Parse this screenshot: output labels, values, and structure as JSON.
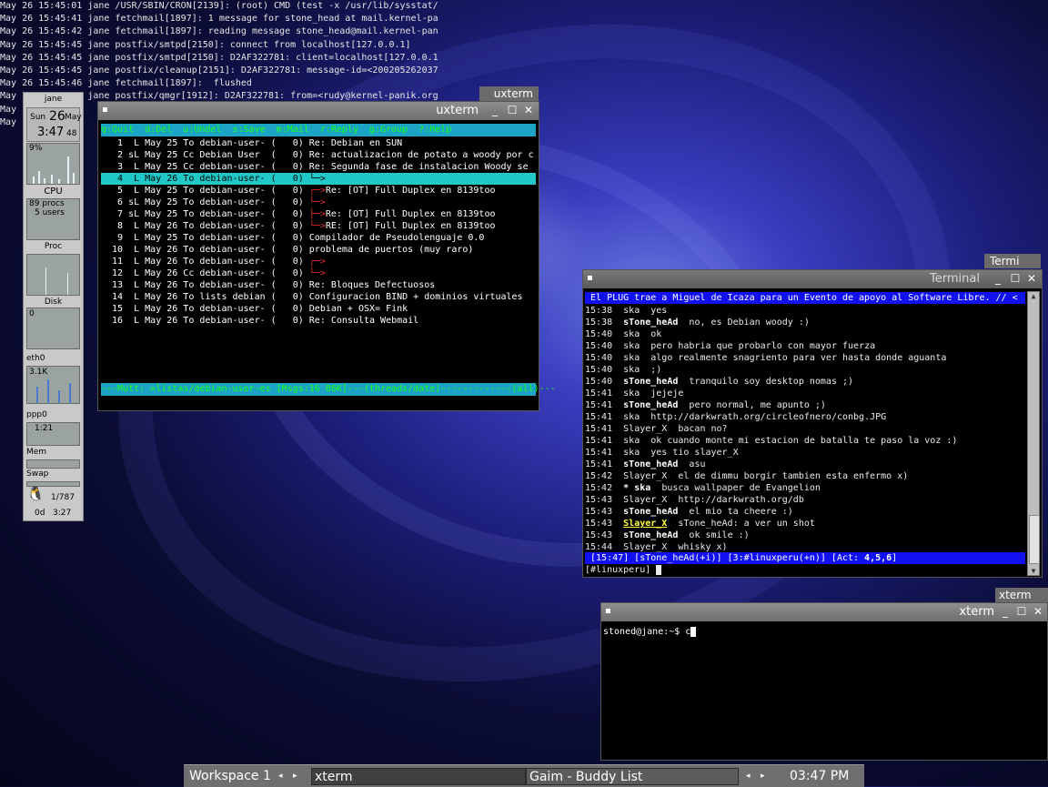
{
  "root_log": [
    "May 26 15:45:01 jane /USR/SBIN/CRON[2139]: (root) CMD (test -x /usr/lib/sysstat/",
    "May 26 15:45:41 jane fetchmail[1897]: 1 message for stone_head at mail.kernel-pa",
    "May 26 15:45:42 jane fetchmail[1897]: reading message stone_head@mail.kernel-pan",
    "May 26 15:45:45 jane postfix/smtpd[2150]: connect from localhost[127.0.0.1]",
    "May 26 15:45:45 jane postfix/smtpd[2150]: D2AF322781: client=localhost[127.0.0.1",
    "May 26 15:45:45 jane postfix/cleanup[2151]: D2AF322781: message-id=<200205262037",
    "May 26 15:45:46 jane fetchmail[1897]:  flushed",
    "May 26 15:45:46 jane postfix/qmgr[1912]: D2AF322781: from=<rudy@kernel-panik.org",
    "May",
    "May"
  ],
  "monitor": {
    "host": "jane",
    "day": "Sun",
    "date": "26",
    "month": "May",
    "time": "3:47",
    "seconds": "48",
    "cpu_pct": "9%",
    "cpu_label": "CPU",
    "procs": "89 procs",
    "users": "5 users",
    "proc_label": "Proc",
    "disk_label": "Disk",
    "disk_val": "0",
    "eth_label": "eth0",
    "eth_val": "3.1K",
    "ppp_label": "ppp0",
    "ppp_val": "1:21",
    "mem_label": "Mem",
    "swap_label": "Swap",
    "mail_count": "1/787",
    "uptime_days": "0d",
    "uptime_time": "3:27"
  },
  "uxterm_back": {
    "title": "uxterm"
  },
  "mutt": {
    "title": "uxterm",
    "help_bar": "q:Quit  d:Del  u:Undel  s:Save  m:Mail  r:Reply  g:Group  ?:Help",
    "status_bar": "---Mutt: =listas/debian-user-es [Msgs:16 86K]---(threads/date)-------------(all)---",
    "rows": [
      {
        "n": "1",
        "f": " L",
        "date": "May 25",
        "who": "To debian-user-",
        "cnt": "(   0)",
        "tree": "",
        "subj": "Re: Debian en SUN"
      },
      {
        "n": "2",
        "f": "sL",
        "date": "May 25",
        "who": "Cc Debian User ",
        "cnt": "(   0)",
        "tree": "",
        "subj": "Re: actualizacion de potato a woody por c"
      },
      {
        "n": "3",
        "f": " L",
        "date": "May 25",
        "who": "Cc debian-user-",
        "cnt": "(   0)",
        "tree": "",
        "subj": "Re: Segunda fase de instalacion Woody se"
      },
      {
        "n": "4",
        "f": " L",
        "date": "May 26",
        "who": "To debian-user-",
        "cnt": "(   0)",
        "tree": "└─>",
        "subj": ""
      },
      {
        "n": "5",
        "f": " L",
        "date": "May 25",
        "who": "To debian-user-",
        "cnt": "(   0)",
        "tree": "┌─>",
        "subj": "Re: [OT] Full Duplex en 8139too"
      },
      {
        "n": "6",
        "f": "sL",
        "date": "May 25",
        "who": "To debian-user-",
        "cnt": "(   0)",
        "tree": "└─>",
        "subj": ""
      },
      {
        "n": "7",
        "f": "sL",
        "date": "May 25",
        "who": "To debian-user-",
        "cnt": "(   0)",
        "tree": "├─>",
        "subj": "Re: [OT] Full Duplex en 8139too"
      },
      {
        "n": "8",
        "f": " L",
        "date": "May 26",
        "who": "To debian-user-",
        "cnt": "(   0)",
        "tree": "└─>",
        "subj": "RE: [OT] Full Duplex en 8139too"
      },
      {
        "n": "9",
        "f": " L",
        "date": "May 25",
        "who": "To debian-user-",
        "cnt": "(   0)",
        "tree": "",
        "subj": "Compilador de Pseudolenguaje 0.0"
      },
      {
        "n": "10",
        "f": " L",
        "date": "May 26",
        "who": "To debian-user-",
        "cnt": "(   0)",
        "tree": "",
        "subj": "problema de puertos (muy raro)"
      },
      {
        "n": "11",
        "f": " L",
        "date": "May 26",
        "who": "To debian-user-",
        "cnt": "(   0)",
        "tree": "┌─>",
        "subj": ""
      },
      {
        "n": "12",
        "f": " L",
        "date": "May 26",
        "who": "Cc debian-user-",
        "cnt": "(   0)",
        "tree": "└─>",
        "subj": ""
      },
      {
        "n": "13",
        "f": " L",
        "date": "May 26",
        "who": "To debian-user-",
        "cnt": "(   0)",
        "tree": "",
        "subj": "Re: Bloques Defectuosos"
      },
      {
        "n": "14",
        "f": " L",
        "date": "May 26",
        "who": "To lists debian",
        "cnt": "(   0)",
        "tree": "",
        "subj": "Configuracion BIND + dominios virtuales"
      },
      {
        "n": "15",
        "f": " L",
        "date": "May 26",
        "who": "To debian-user-",
        "cnt": "(   0)",
        "tree": "",
        "subj": "Debian + OSX= Fink"
      },
      {
        "n": "16",
        "f": " L",
        "date": "May 26",
        "who": "To debian-user-",
        "cnt": "(   0)",
        "tree": "",
        "subj": "Re: Consulta Webmail"
      }
    ]
  },
  "termi_back": {
    "title": "Termi"
  },
  "irc": {
    "title": "Terminal",
    "topic": " El PLUG trae a Miguel de Icaza para un Evento de apoyo al Software Libre. // <",
    "lines": [
      {
        "t": "15:38",
        "nick": "ska",
        "style": "n",
        "msg": "yes"
      },
      {
        "t": "15:38",
        "nick": "sTone_heAd",
        "style": "b",
        "msg": "no, es Debian woody :)"
      },
      {
        "t": "15:40",
        "nick": "ska",
        "style": "n",
        "msg": "ok"
      },
      {
        "t": "15:40",
        "nick": "ska",
        "style": "n",
        "msg": "pero habria que probarlo con mayor fuerza"
      },
      {
        "t": "15:40",
        "nick": "ska",
        "style": "n",
        "msg": "algo realmente snagriento para ver hasta donde aguanta"
      },
      {
        "t": "15:40",
        "nick": "ska",
        "style": "n",
        "msg": ";)"
      },
      {
        "t": "15:40",
        "nick": "sTone_heAd",
        "style": "b",
        "msg": "tranquilo soy desktop nomas ;)"
      },
      {
        "t": "15:41",
        "nick": "ska",
        "style": "n",
        "msg": "jejeje"
      },
      {
        "t": "15:41",
        "nick": "sTone_heAd",
        "style": "b",
        "msg": "pero normal, me apunto ;)"
      },
      {
        "t": "15:41",
        "nick": "ska",
        "style": "n",
        "msg": "http://darkwrath.org/circleofnero/conbg.JPG"
      },
      {
        "t": "15:41",
        "nick": "Slayer_X",
        "style": "n",
        "msg": "bacan no?"
      },
      {
        "t": "15:41",
        "nick": "ska",
        "style": "n",
        "msg": "ok cuando monte mi estacion de batalla te paso la voz :)"
      },
      {
        "t": "15:41",
        "nick": "ska",
        "style": "n",
        "msg": "yes tio slayer_X"
      },
      {
        "t": "15:41",
        "nick": "sTone_heAd",
        "style": "b",
        "msg": "asu"
      },
      {
        "t": "15:42",
        "nick": "Slayer_X",
        "style": "n",
        "msg": "el de dimmu borgir tambien esta enfermo x)"
      },
      {
        "t": "15:42",
        "nick": "* ska",
        "style": "a",
        "msg": "busca wallpaper de Evangelion"
      },
      {
        "t": "15:43",
        "nick": "Slayer_X",
        "style": "n",
        "msg": "http://darkwrath.org/db"
      },
      {
        "t": "15:43",
        "nick": "sTone_heAd",
        "style": "b",
        "msg": "el mio ta cheere :)"
      },
      {
        "t": "15:43",
        "nick": "Slayer_X",
        "style": "y",
        "msg": "sTone_heAd: a ver un shot"
      },
      {
        "t": "15:43",
        "nick": "sTone_heAd",
        "style": "b",
        "msg": "ok smile :)"
      },
      {
        "t": "15:44",
        "nick": "Slayer_X",
        "style": "n",
        "msg": "whisky x)"
      }
    ],
    "status_pre": " [15:47] [sTone_heAd(+i)] [3:#linuxperu(+n)] [Act: ",
    "status_act": "4,5,6",
    "status_post": "]",
    "prompt": "[#linuxperu] "
  },
  "xterm_back": {
    "title": "xterm"
  },
  "xterm": {
    "title": "xterm",
    "prompt": "stoned@jane:~$ c"
  },
  "taskbar": {
    "workspace": "Workspace 1",
    "task1": "xterm",
    "task2": "Gaim - Buddy List",
    "clock": "03:47 PM"
  }
}
